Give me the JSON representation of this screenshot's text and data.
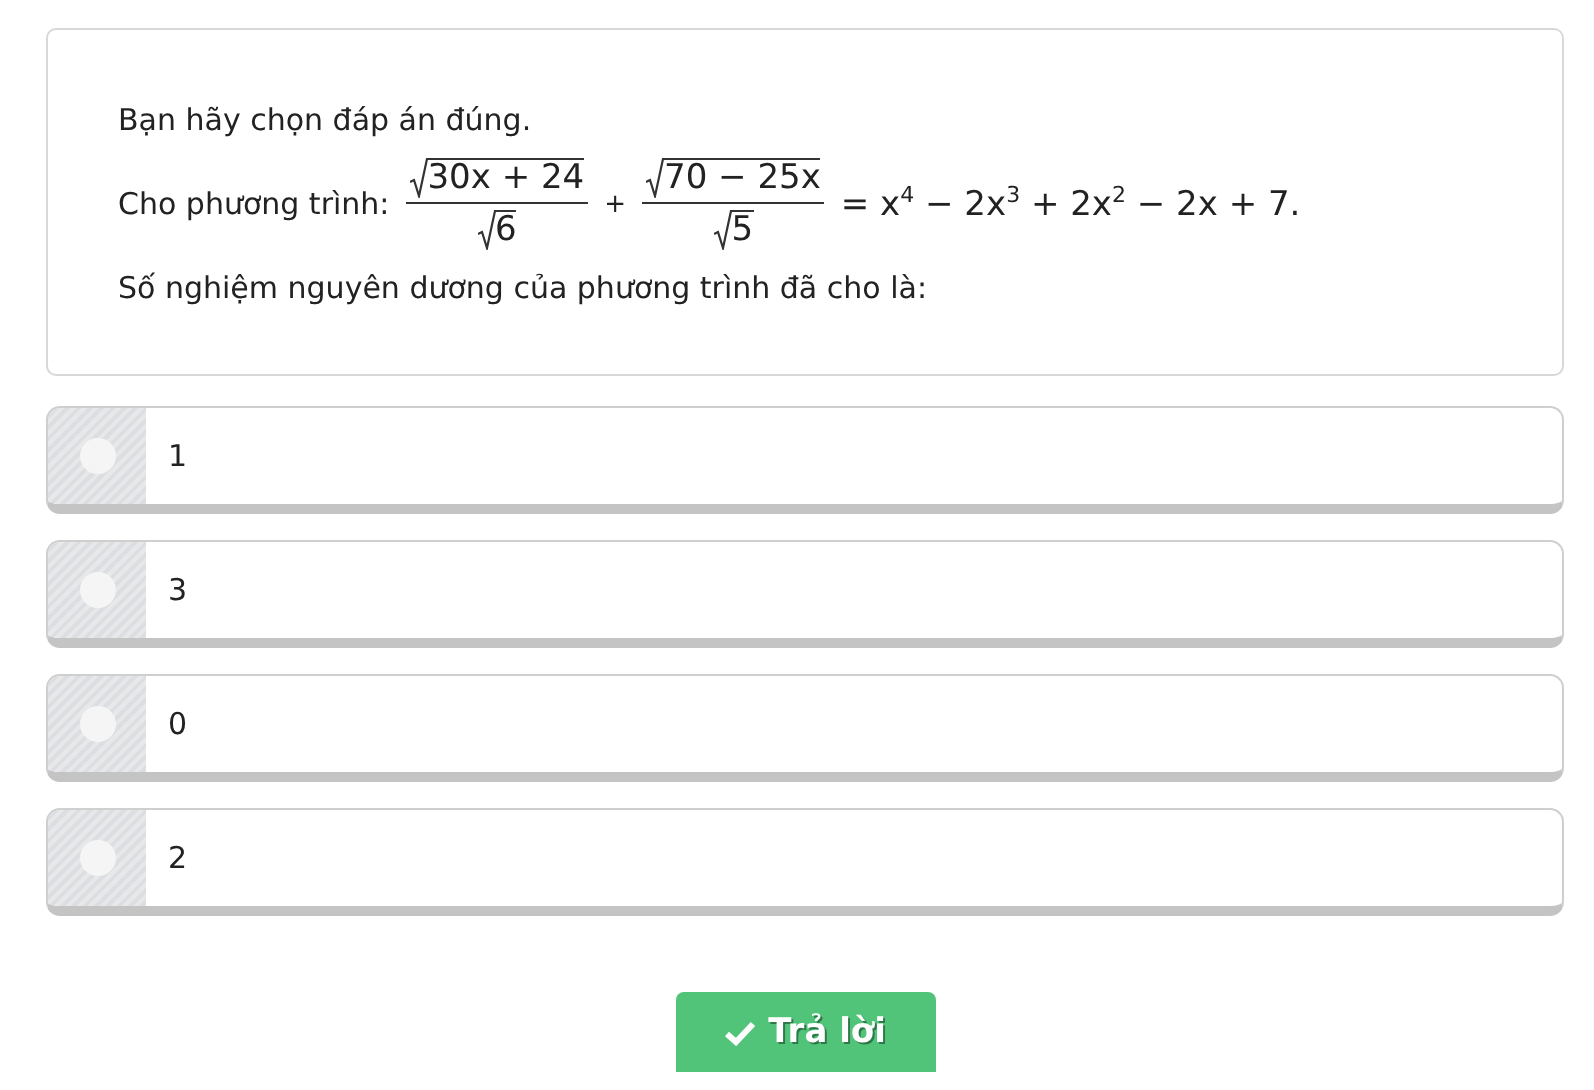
{
  "question": {
    "instruction": "Bạn hãy chọn đáp án đúng.",
    "equation_label": "Cho phương trình:",
    "fractions": [
      {
        "numerator": "30x + 24",
        "denominator": "6"
      },
      {
        "numerator": "70 − 25x",
        "denominator": "5"
      }
    ],
    "operator": "+",
    "rhs": "= x$^{4}$ − 2x$^{3}$ + 2x$^{2}$ − 2x + 7.",
    "ask": "Số nghiệm nguyên dương của phương trình đã cho là:"
  },
  "options": [
    {
      "label": "1",
      "selected": false
    },
    {
      "label": "3",
      "selected": false
    },
    {
      "label": "0",
      "selected": false
    },
    {
      "label": "2",
      "selected": false
    }
  ],
  "submit_button": "Trả lời"
}
